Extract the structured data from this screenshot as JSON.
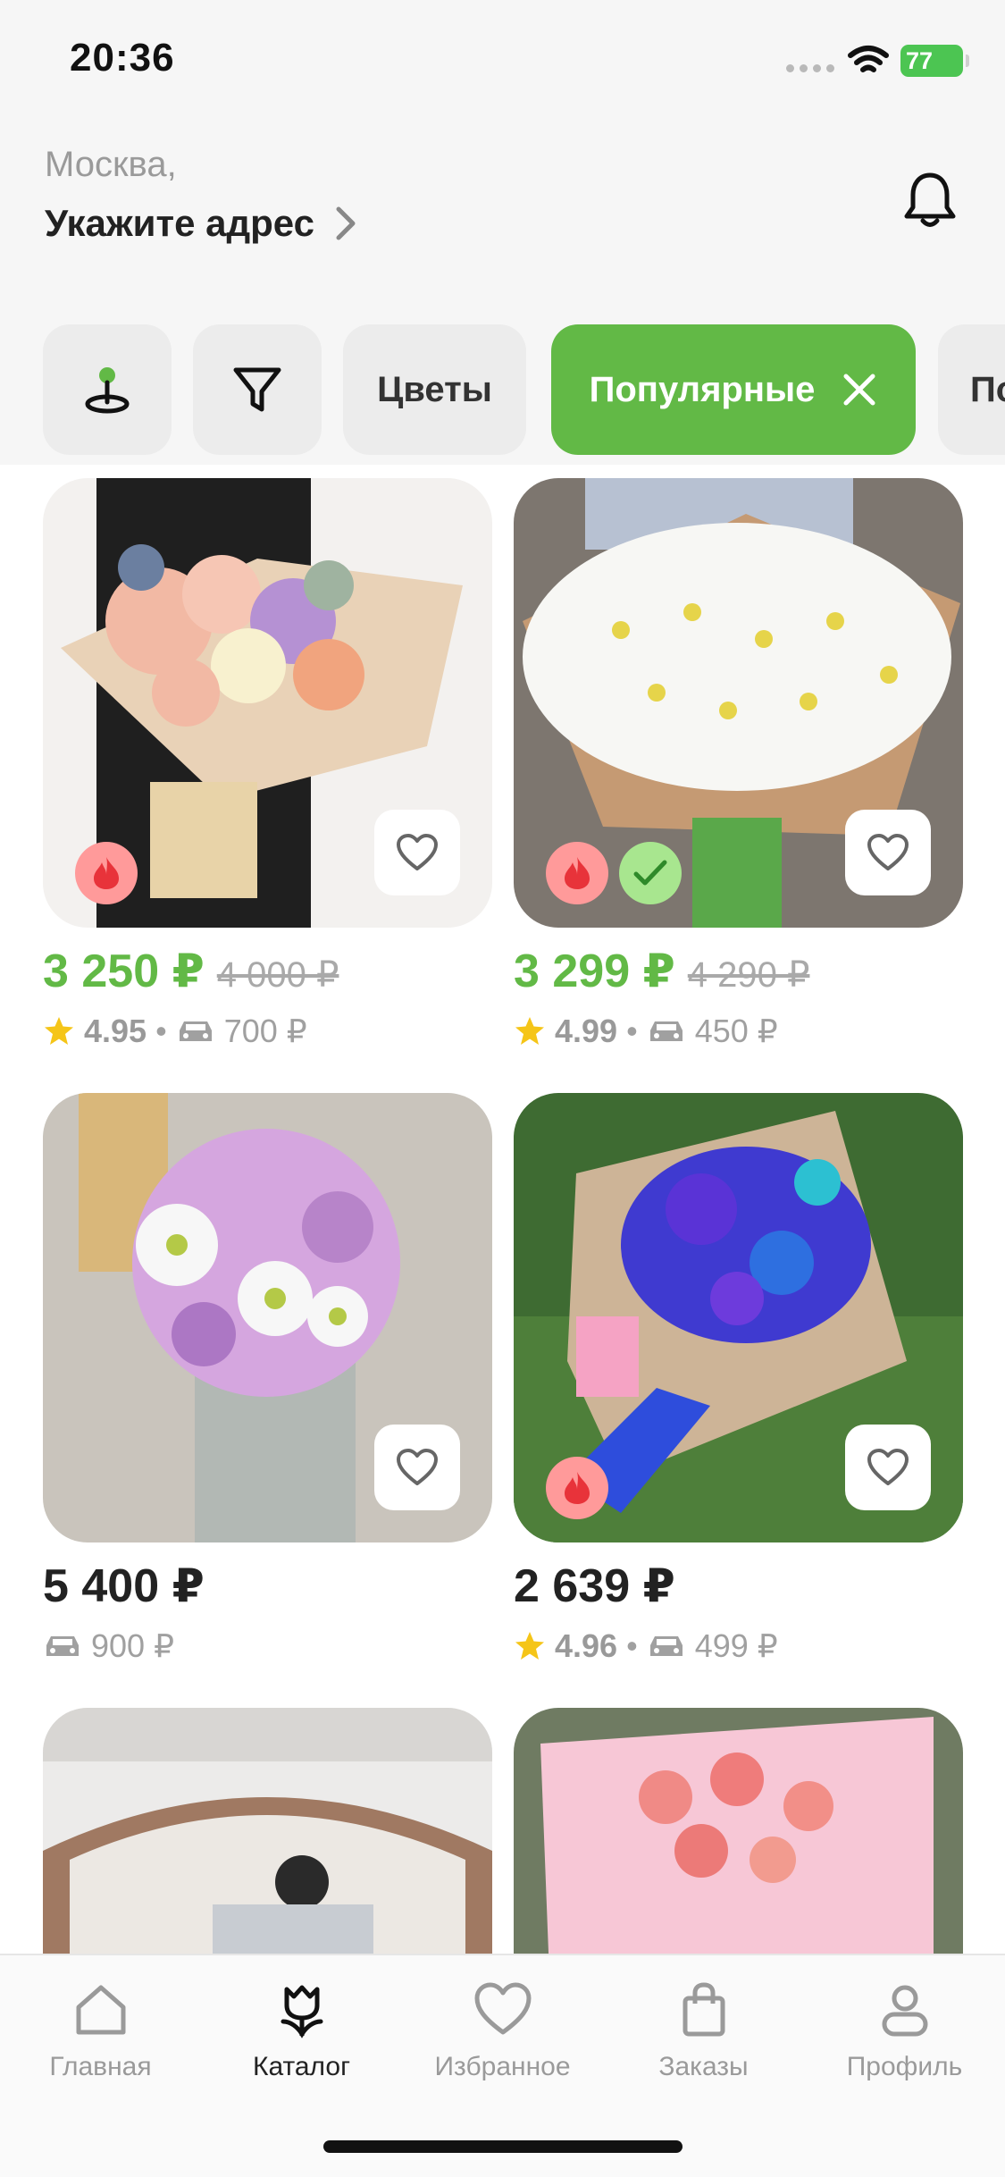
{
  "status_bar": {
    "time": "20:36",
    "battery": "77"
  },
  "header": {
    "city": "Москва,",
    "address_prompt": "Укажите адрес"
  },
  "filters": {
    "map_icon": "location-pin-icon",
    "filter_icon": "funnel-icon",
    "chip_flowers": "Цветы",
    "chip_popular": "Популярные",
    "chip_next": "По"
  },
  "products": [
    {
      "price": "3 250 ₽",
      "old_price": "4 000 ₽",
      "rating": "4.95",
      "delivery": "700 ₽",
      "badges": [
        "hot"
      ]
    },
    {
      "price": "3 299 ₽",
      "old_price": "4 290 ₽",
      "rating": "4.99",
      "delivery": "450 ₽",
      "badges": [
        "hot",
        "verified"
      ]
    },
    {
      "price": "5 400 ₽",
      "delivery": "900 ₽",
      "badges": []
    },
    {
      "price": "2 639 ₽",
      "rating": "4.96",
      "delivery": "499 ₽",
      "badges": [
        "hot"
      ]
    },
    {
      "badges": []
    },
    {
      "badges": []
    }
  ],
  "separator": "•",
  "bottom_nav": [
    {
      "label": "Главная",
      "icon": "home-icon"
    },
    {
      "label": "Каталог",
      "icon": "tulip-icon",
      "active": true
    },
    {
      "label": "Избранное",
      "icon": "heart-icon"
    },
    {
      "label": "Заказы",
      "icon": "bag-icon"
    },
    {
      "label": "Профиль",
      "icon": "person-icon"
    }
  ],
  "colors": {
    "accent": "#62b946",
    "hot_badge": "#ff9a9a",
    "verified_badge": "#a8e68f"
  }
}
